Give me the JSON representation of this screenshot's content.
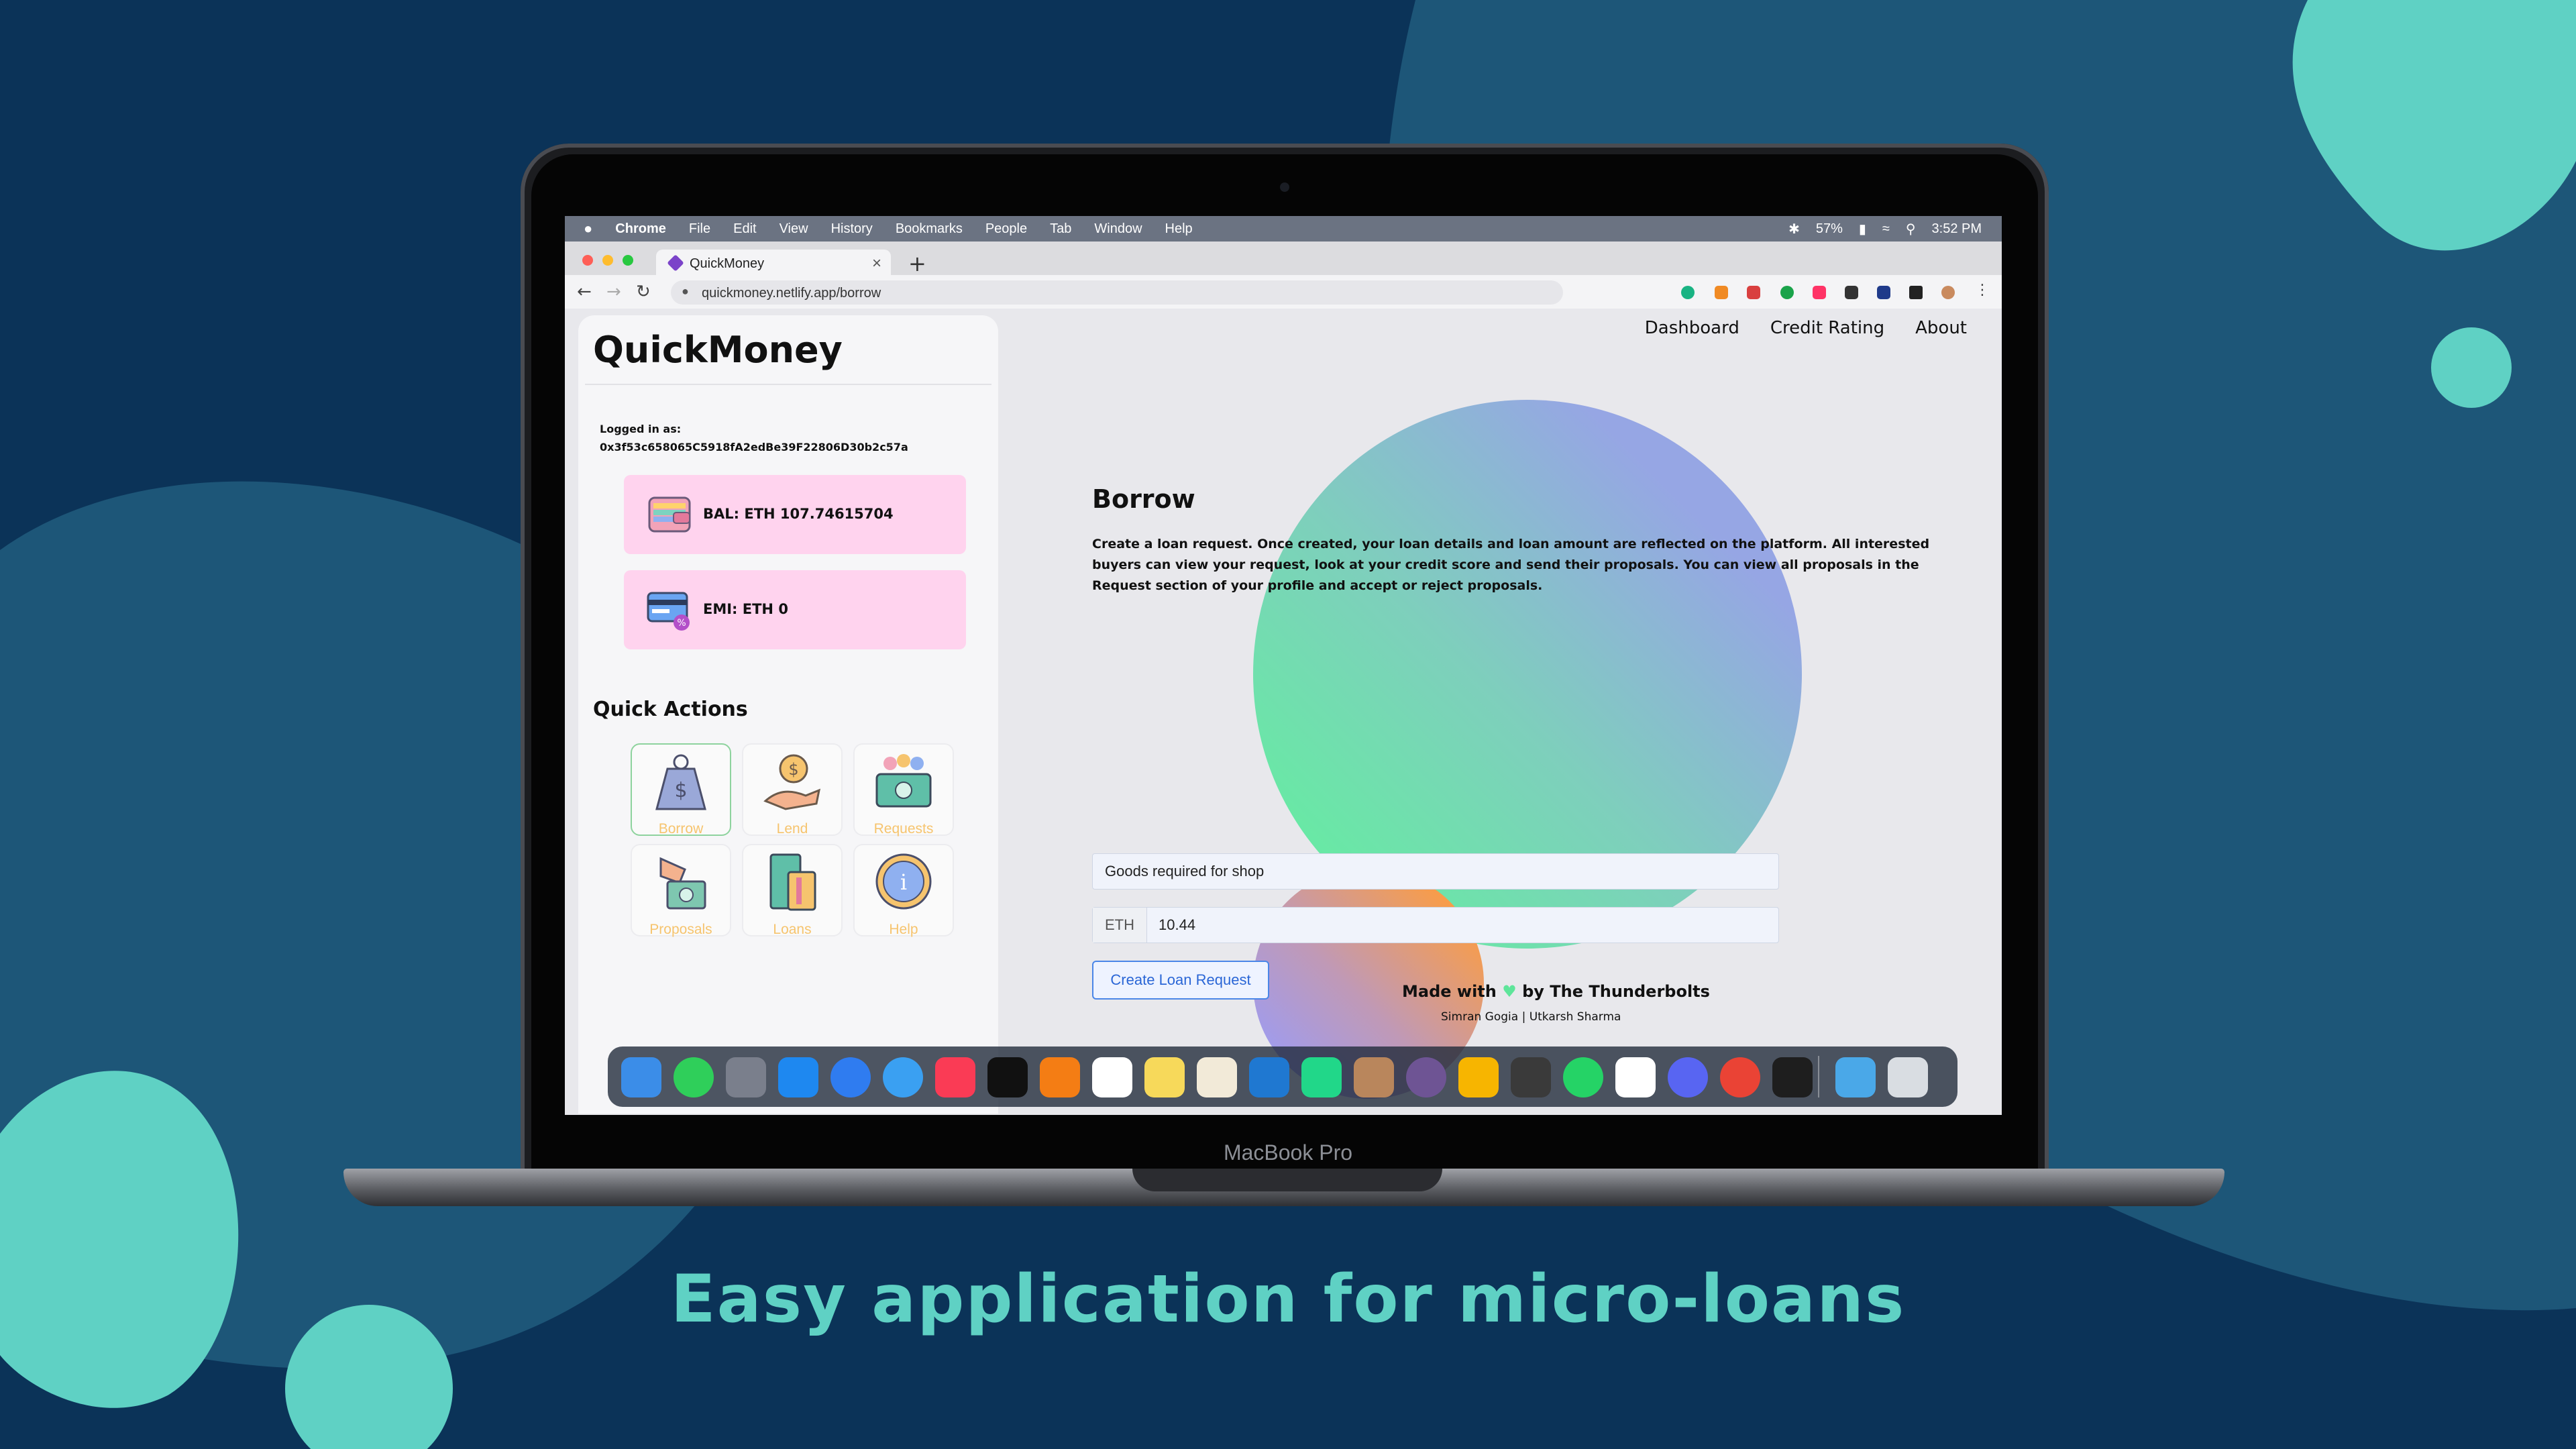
{
  "tagline": "Easy application for micro-loans",
  "device_label": "MacBook Pro",
  "menubar": {
    "app": "Chrome",
    "items": [
      "File",
      "Edit",
      "View",
      "History",
      "Bookmarks",
      "People",
      "Tab",
      "Window",
      "Help"
    ],
    "battery": "57%",
    "clock": "3:52 PM"
  },
  "browser": {
    "tab_title": "QuickMoney",
    "new_tab": "+",
    "url": "quickmoney.netlify.app/borrow"
  },
  "app": {
    "logo": "QuickMoney",
    "logged_in_label": "Logged in as:",
    "account": "0x3f53c658065C5918fA2edBe39F22806D30b2c57a",
    "balance": "BAL: ETH 107.74615704",
    "emi": "EMI: ETH 0",
    "quick_actions_title": "Quick Actions",
    "quick_actions": [
      "Borrow",
      "Lend",
      "Requests",
      "Proposals",
      "Loans",
      "Help"
    ],
    "nav": [
      "Dashboard",
      "Credit Rating",
      "About"
    ]
  },
  "borrow": {
    "title": "Borrow",
    "description": "Create a loan request. Once created, your loan details and loan amount are reflected on the platform. All interested buyers can view your request, look at your credit score and send their proposals. You can view all proposals in the Request section of your profile and accept or reject proposals.",
    "purpose_value": "Goods required for shop",
    "currency": "ETH",
    "amount_value": "10.44",
    "submit_label": "Create Loan Request"
  },
  "footer": {
    "made_with": "Made with",
    "by": "by The Thunderbolts",
    "authors": "Simran Gogia | Utkarsh Sharma"
  },
  "colors": {
    "background": "#0b3358",
    "accent_teal": "#5fd1c4",
    "card_pink": "#ffd3ee",
    "quick_action_label": "#f6c46e",
    "button_blue": "#4a86e8"
  }
}
